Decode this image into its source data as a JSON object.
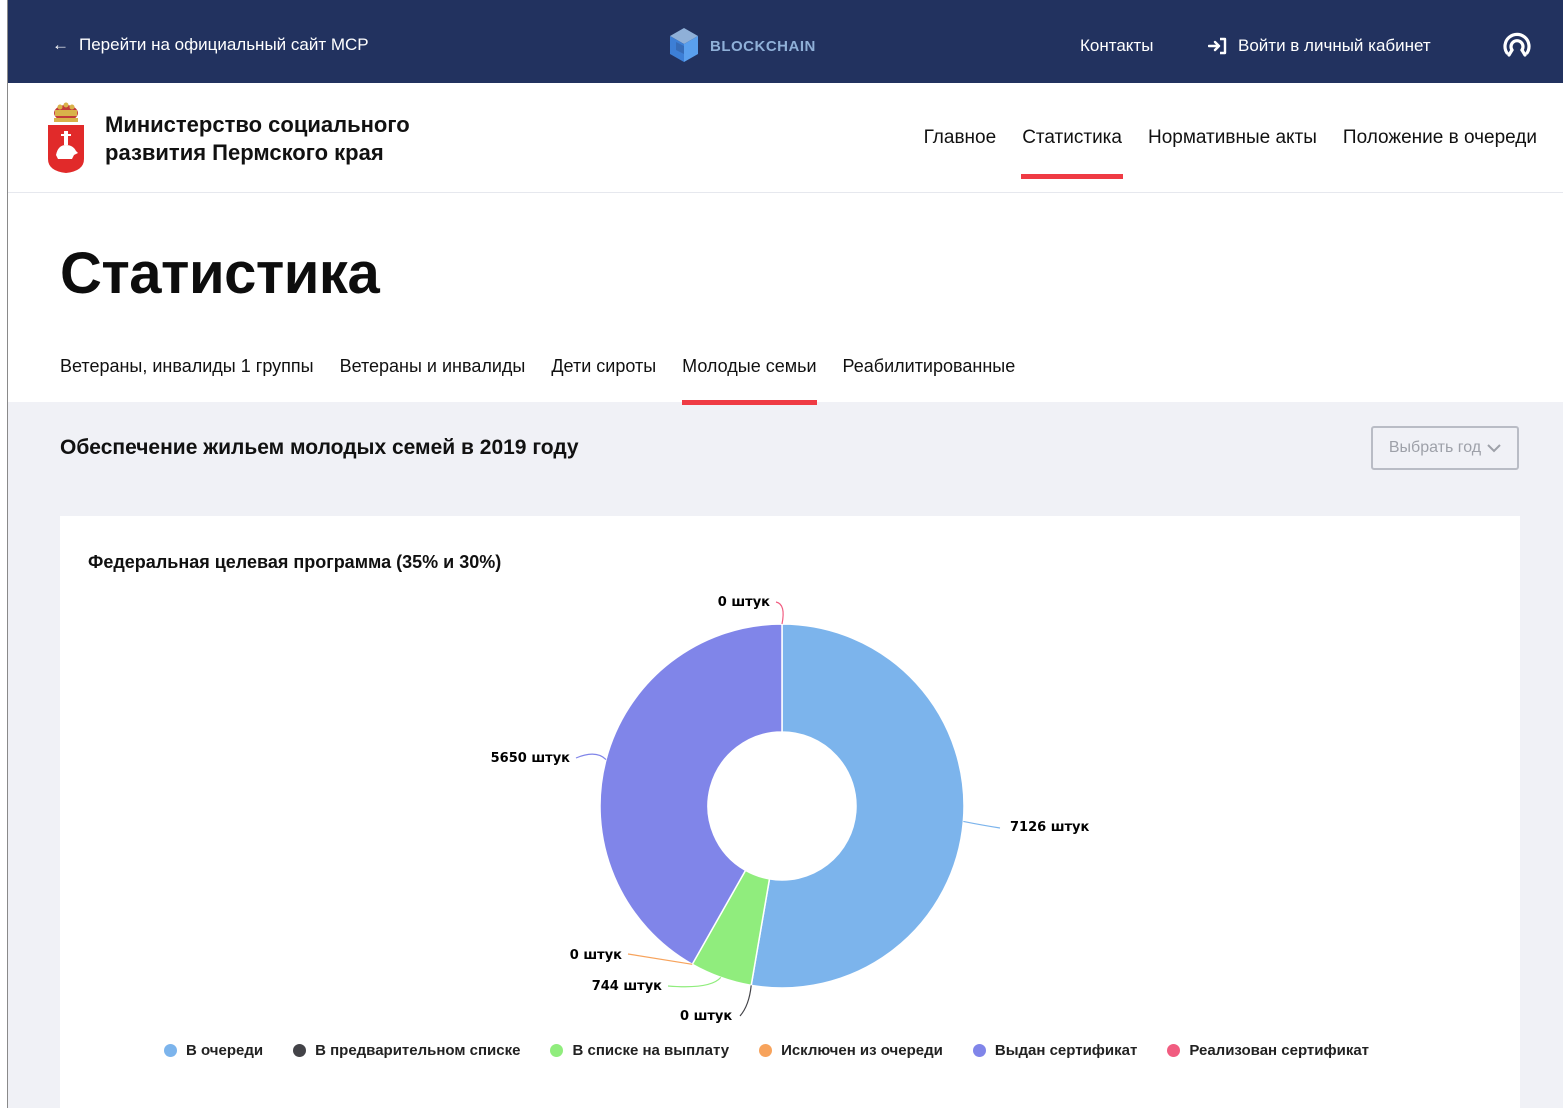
{
  "topbar": {
    "back_label": "Перейти на официальный сайт МСР",
    "brand_label": "BLOCKCHAIN",
    "contacts_label": "Контакты",
    "login_label": "Войти в личный кабинет"
  },
  "header": {
    "org_line1": "Министерство социального",
    "org_line2": "развития Пермского края",
    "nav": [
      {
        "label": "Главное"
      },
      {
        "label": "Статистика"
      },
      {
        "label": "Нормативные акты"
      },
      {
        "label": "Положение в очереди"
      }
    ],
    "active_nav": 1
  },
  "page_title": "Статистика",
  "tabs": [
    {
      "label": "Ветераны, инвалиды 1 группы"
    },
    {
      "label": "Ветераны и инвалиды"
    },
    {
      "label": "Дети сироты"
    },
    {
      "label": "Молодые семьи"
    },
    {
      "label": "Реабилитированные"
    }
  ],
  "active_tab": 3,
  "section_title": "Обеспечение жильем молодых семей в 2019 году",
  "year_button_label": "Выбрать год",
  "card_title": "Федеральная целевая программа (35% и 30%)",
  "colors": {
    "topbar": "#22325f",
    "accent": "#ef3b44"
  },
  "chart_data": {
    "type": "pie",
    "subtype": "donut",
    "unit": "штук",
    "categories": [
      "В очереди",
      "В предварительном списке",
      "В списке на выплату",
      "Исключен из очереди",
      "Выдан сертификат",
      "Реализован сертификат"
    ],
    "values": [
      7126,
      0,
      744,
      0,
      5650,
      0
    ],
    "labels": [
      "7126 штук",
      "0 штук",
      "744 штук",
      "0 штук",
      "5650 штук",
      "0 штук"
    ],
    "colors": [
      "#7cb4ec",
      "#434348",
      "#90ed7d",
      "#f7a35c",
      "#8085e9",
      "#f15c80"
    ],
    "legend_position": "bottom"
  }
}
